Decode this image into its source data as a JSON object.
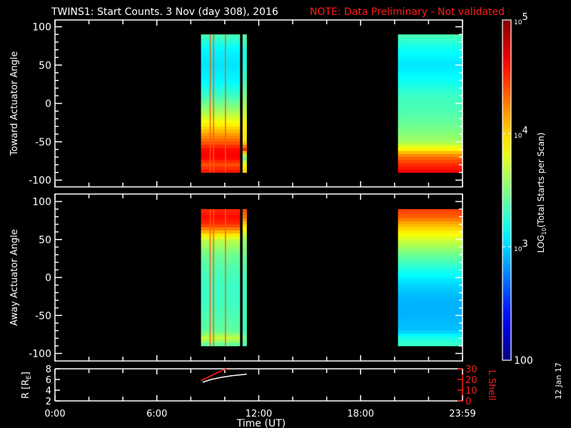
{
  "title": {
    "main": "TWINS1: Start Counts.  3 Nov (day 308), 2016",
    "note": "NOTE: Data Preliminary - Not validated",
    "note_color": "#ff1a1a"
  },
  "date_stamp": "12 Jan 17",
  "chart_data": [
    {
      "type": "heatmap",
      "name": "toward",
      "ylabel": "Toward Actuator Angle",
      "ylim": [
        -100,
        100
      ],
      "yticks": [
        100,
        50,
        0,
        -50,
        -100
      ],
      "angles": [
        90,
        70,
        50,
        30,
        10,
        -10,
        -30,
        -50,
        -60,
        -70,
        -80,
        -90
      ],
      "blocks": [
        {
          "t_start": 8.6,
          "t_end": 10.9,
          "log_counts": [
            3.35,
            3.1,
            3.05,
            3.1,
            3.3,
            3.6,
            3.95,
            4.35,
            4.6,
            4.65,
            4.4,
            4.6
          ]
        },
        {
          "t_start": 11.05,
          "t_end": 11.3,
          "log_counts": [
            3.4,
            3.2,
            3.2,
            3.3,
            3.5,
            3.7,
            3.9,
            3.95,
            4.5,
            3.4,
            3.9,
            4.0
          ]
        },
        {
          "t_start": 20.2,
          "t_end": 24.0,
          "log_counts": [
            3.35,
            3.15,
            3.05,
            3.15,
            3.3,
            3.35,
            3.45,
            3.6,
            3.9,
            4.3,
            4.5,
            4.65
          ]
        }
      ]
    },
    {
      "type": "heatmap",
      "name": "away",
      "ylabel": "Away Actuator Angle",
      "ylim": [
        -100,
        100
      ],
      "yticks": [
        100,
        50,
        0,
        -50,
        -100
      ],
      "angles": [
        90,
        80,
        70,
        50,
        30,
        10,
        -10,
        -30,
        -50,
        -70,
        -80,
        -90
      ],
      "blocks": [
        {
          "t_start": 8.6,
          "t_end": 10.9,
          "log_counts": [
            4.5,
            4.6,
            4.5,
            3.7,
            3.45,
            3.35,
            3.3,
            3.3,
            3.35,
            3.4,
            3.7,
            3.35
          ]
        },
        {
          "t_start": 11.05,
          "t_end": 11.3,
          "log_counts": [
            4.4,
            4.3,
            4.0,
            3.6,
            3.45,
            3.35,
            3.3,
            3.3,
            3.3,
            3.3,
            3.5,
            3.3
          ]
        },
        {
          "t_start": 20.2,
          "t_end": 24.0,
          "log_counts": [
            4.45,
            4.35,
            4.1,
            3.75,
            3.45,
            3.2,
            3.0,
            2.9,
            2.9,
            2.95,
            3.2,
            3.3
          ]
        }
      ]
    },
    {
      "type": "line",
      "name": "orbit",
      "ylabel": "R [RE]",
      "ylabel_main": "R [R",
      "ylabel_sub": "E",
      "ylabel_end": "]",
      "ylim": [
        2,
        8
      ],
      "yticks": [
        8,
        6,
        4,
        2
      ],
      "y2label": "L Shell",
      "y2lim": [
        0,
        30
      ],
      "y2ticks": [
        30,
        20,
        10,
        0
      ],
      "series": [
        {
          "name": "R",
          "color": "#ffffff",
          "x": [
            8.7,
            9.2,
            9.8,
            10.4,
            11.0,
            11.3
          ],
          "y": [
            5.5,
            6.0,
            6.4,
            6.7,
            6.9,
            7.0
          ]
        },
        {
          "name": "L Shell",
          "color": "#ff1a1a",
          "x": [
            8.6,
            9.0,
            9.5,
            10.1
          ],
          "y": [
            19,
            22,
            26,
            30
          ]
        }
      ]
    }
  ],
  "xaxis": {
    "label": "Time (UT)",
    "xlim": [
      0,
      24
    ],
    "ticks": [
      {
        "h": 0,
        "label": "0:00"
      },
      {
        "h": 6,
        "label": "6:00"
      },
      {
        "h": 12,
        "label": "12:00"
      },
      {
        "h": 18,
        "label": "18:00"
      },
      {
        "h": 24,
        "label": "23:59"
      }
    ]
  },
  "colorbar": {
    "label_main": "LOG",
    "label_sub": "10",
    "label_end": "(Total Starts per Scan)",
    "range_log": [
      2,
      5
    ],
    "ticks": [
      {
        "v": 5,
        "base": "10",
        "exp": "5"
      },
      {
        "v": 4,
        "base": "10",
        "exp": "4"
      },
      {
        "v": 3,
        "base": "10",
        "exp": "3"
      },
      {
        "v": 2,
        "base": "100",
        "exp": ""
      }
    ]
  }
}
